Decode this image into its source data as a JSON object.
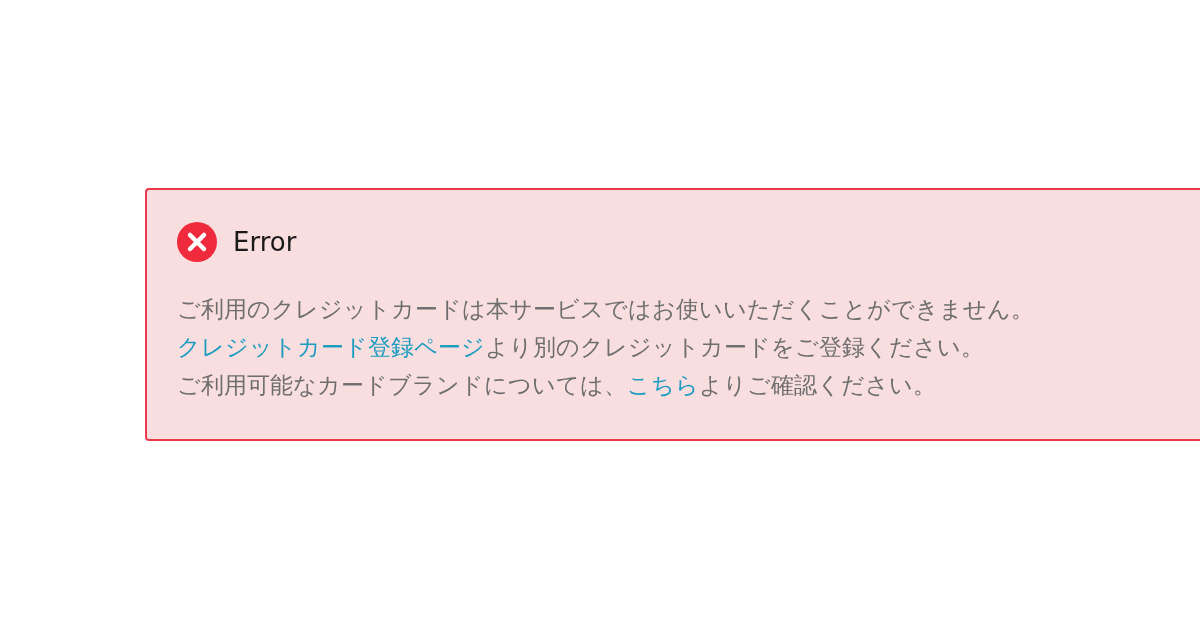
{
  "alert": {
    "kind": "error",
    "title": "Error",
    "lines": [
      [
        {
          "kind": "text",
          "text": "ご利用のクレジットカードは本サービスではお使いいただくことができません。"
        }
      ],
      [
        {
          "kind": "link",
          "text": "クレジットカード登録ページ"
        },
        {
          "kind": "text",
          "text": "より別のクレジットカードをご登録ください。"
        }
      ],
      [
        {
          "kind": "text",
          "text": "ご利用可能なカードブランドについては、"
        },
        {
          "kind": "link",
          "text": "こちら"
        },
        {
          "kind": "text",
          "text": "よりご確認ください。"
        }
      ]
    ]
  }
}
